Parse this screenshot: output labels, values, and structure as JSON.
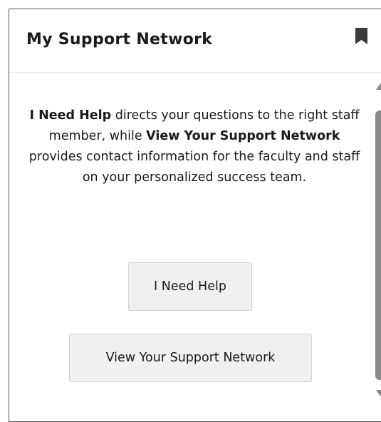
{
  "card": {
    "title": "My Support Network"
  },
  "description": {
    "part1_bold": "I Need Help",
    "part2": " directs your questions to the right staff member, while ",
    "part3_bold": "View Your Support Network",
    "part4": " provides contact information for the faculty and staff on your personalized success team."
  },
  "buttons": {
    "need_help_label": "I Need Help",
    "view_network_label": "View Your Support Network"
  },
  "icons": {
    "bookmark": "bookmark-icon",
    "scroll_up": "scroll-up-arrow-icon",
    "scroll_down": "scroll-down-arrow-icon"
  },
  "colors": {
    "button_bg": "#f0f0f0",
    "scrollbar": "#8a8a8a",
    "border": "#555555",
    "text": "#1a1a1a"
  }
}
